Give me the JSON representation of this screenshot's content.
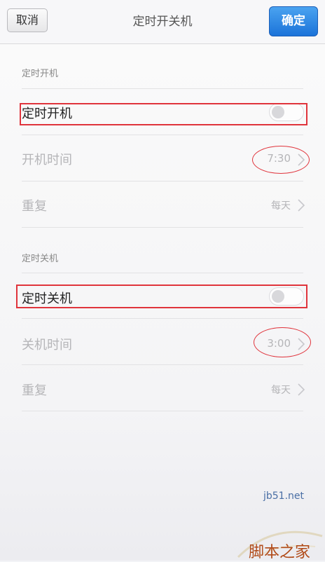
{
  "header": {
    "cancel_label": "取消",
    "title": "定时开关机",
    "confirm_label": "确定"
  },
  "power_on": {
    "section_title": "定时开机",
    "toggle_label": "定时开机",
    "toggle_on": false,
    "time_label": "开机时间",
    "time_value": "7:30",
    "repeat_label": "重复",
    "repeat_value": "每天"
  },
  "power_off": {
    "section_title": "定时关机",
    "toggle_label": "定时关机",
    "toggle_on": false,
    "time_label": "关机时间",
    "time_value": "3:00",
    "repeat_label": "重复",
    "repeat_value": "每天"
  },
  "watermark": {
    "url": "jb51.net",
    "brand": "脚本之家"
  },
  "colors": {
    "confirm_button": "#1b73d9",
    "annotation": "#e0343c"
  }
}
